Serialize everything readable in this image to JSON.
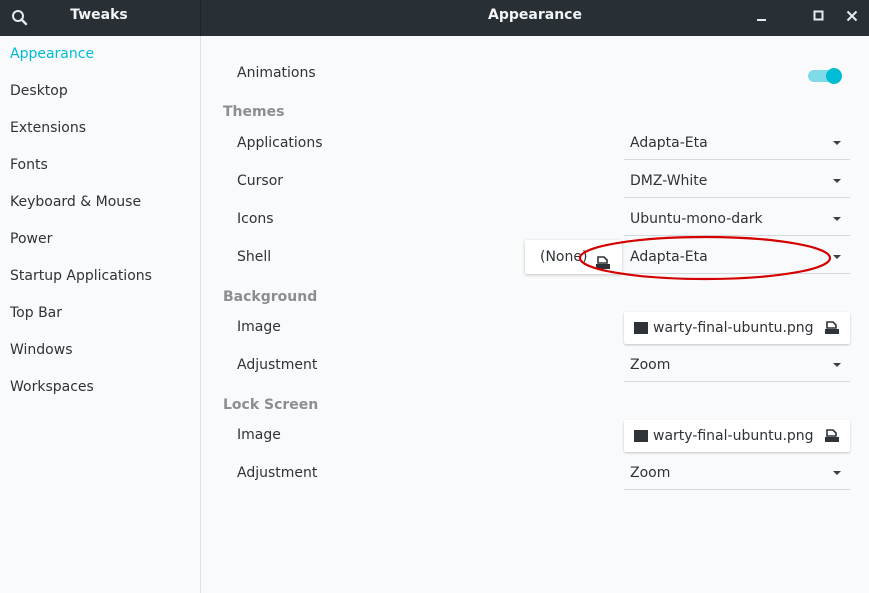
{
  "header": {
    "app_title": "Tweaks",
    "page_title": "Appearance",
    "search_icon": "search-icon",
    "window_controls": [
      "minimize-icon",
      "maximize-icon",
      "close-icon"
    ]
  },
  "sidebar": {
    "items": [
      {
        "label": "Appearance",
        "active": true
      },
      {
        "label": "Desktop"
      },
      {
        "label": "Extensions"
      },
      {
        "label": "Fonts"
      },
      {
        "label": "Keyboard & Mouse"
      },
      {
        "label": "Power"
      },
      {
        "label": "Startup Applications"
      },
      {
        "label": "Top Bar"
      },
      {
        "label": "Windows"
      },
      {
        "label": "Workspaces"
      }
    ]
  },
  "main": {
    "animations": {
      "label": "Animations",
      "enabled": true
    },
    "themes": {
      "heading": "Themes",
      "applications": {
        "label": "Applications",
        "value": "Adapta-Eta"
      },
      "cursor": {
        "label": "Cursor",
        "value": "DMZ-White"
      },
      "icons": {
        "label": "Icons",
        "value": "Ubuntu-mono-dark"
      },
      "shell": {
        "label": "Shell",
        "value": "Adapta-Eta",
        "popup_value": "(None)"
      }
    },
    "background": {
      "heading": "Background",
      "image": {
        "label": "Image",
        "value": "warty-final-ubuntu.png"
      },
      "adjustment": {
        "label": "Adjustment",
        "value": "Zoom"
      }
    },
    "lock_screen": {
      "heading": "Lock Screen",
      "image": {
        "label": "Image",
        "value": "warty-final-ubuntu.png"
      },
      "adjustment": {
        "label": "Adjustment",
        "value": "Zoom"
      }
    }
  },
  "colors": {
    "accent": "#00bcd4",
    "headerbar": "#283036",
    "annotation": "#d40000"
  }
}
